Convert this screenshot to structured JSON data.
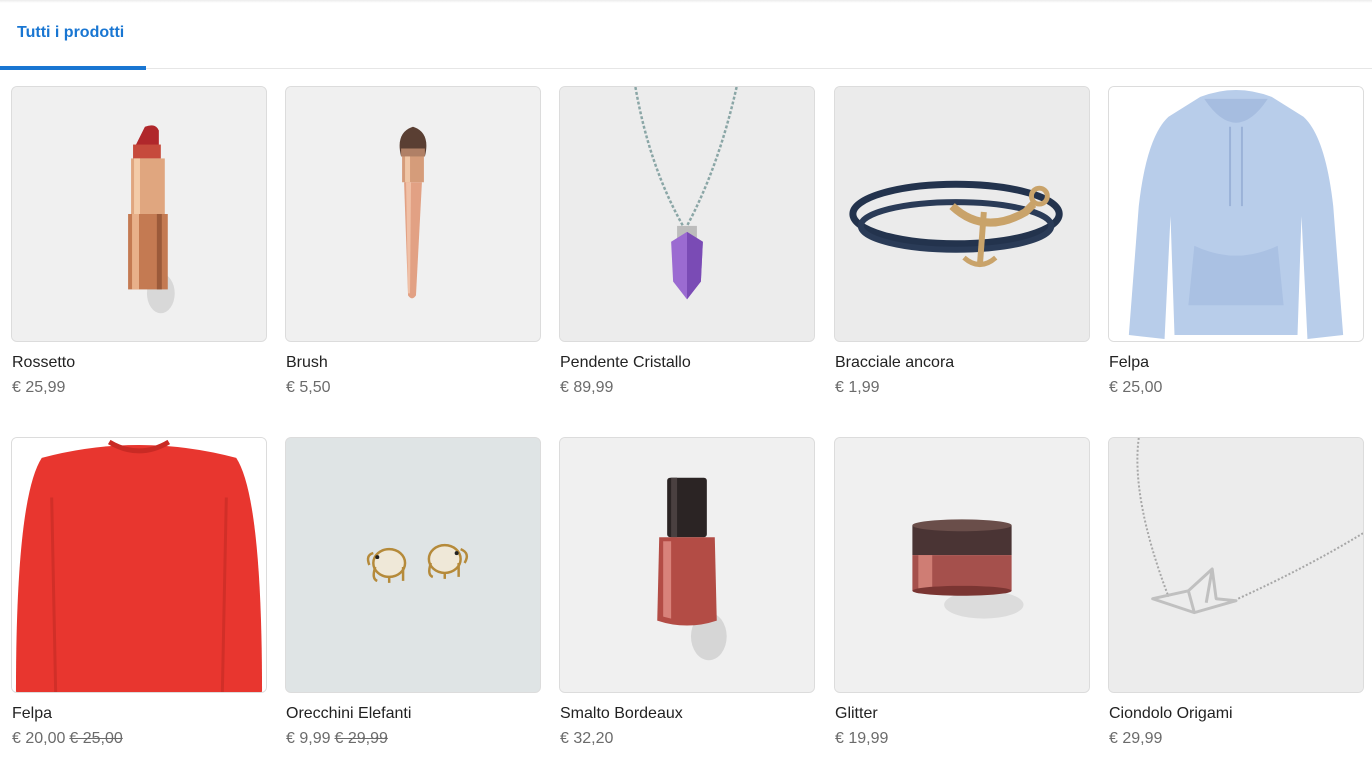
{
  "tabs": [
    {
      "label": "Tutti i prodotti",
      "active": true
    }
  ],
  "accent_color": "#1976d2",
  "products": [
    {
      "name": "Rossetto",
      "price": "€ 25,99",
      "old_price": "",
      "image_icon": "lipstick-icon"
    },
    {
      "name": "Brush",
      "price": "€ 5,50",
      "old_price": "",
      "image_icon": "makeup-brush-icon"
    },
    {
      "name": "Pendente Cristallo",
      "price": "€ 89,99",
      "old_price": "",
      "image_icon": "crystal-pendant-icon"
    },
    {
      "name": "Bracciale ancora",
      "price": "€ 1,99",
      "old_price": "",
      "image_icon": "anchor-bracelet-icon"
    },
    {
      "name": "Felpa",
      "price": "€ 25,00",
      "old_price": "",
      "image_icon": "blue-hoodie-icon"
    },
    {
      "name": "Felpa",
      "price": "€ 20,00",
      "old_price": "€ 25,00",
      "image_icon": "red-sweatshirt-icon"
    },
    {
      "name": "Orecchini Elefanti",
      "price": "€ 9,99",
      "old_price": "€ 29,99",
      "image_icon": "elephant-earrings-icon"
    },
    {
      "name": "Smalto Bordeaux",
      "price": "€ 32,20",
      "old_price": "",
      "image_icon": "nail-polish-icon"
    },
    {
      "name": "Glitter",
      "price": "€ 19,99",
      "old_price": "",
      "image_icon": "glitter-jar-icon"
    },
    {
      "name": "Ciondolo Origami",
      "price": "€ 29,99",
      "old_price": "",
      "image_icon": "origami-pendant-icon"
    }
  ]
}
